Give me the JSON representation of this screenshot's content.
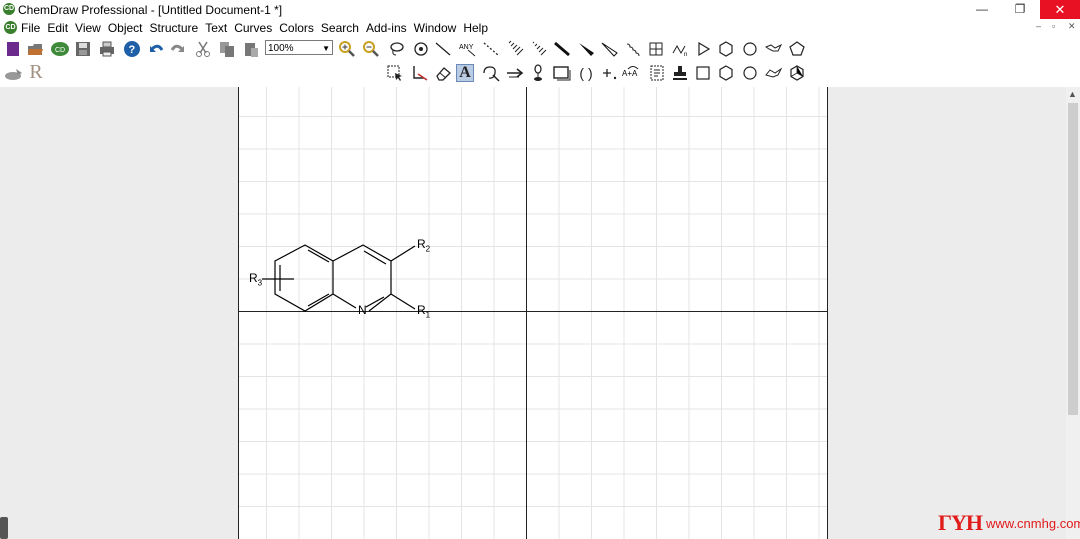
{
  "window": {
    "title": "ChemDraw Professional - [Untitled Document-1 *]",
    "app_icon": "CD",
    "controls": {
      "minimize": "—",
      "maximize": "❐",
      "close": "✕"
    }
  },
  "menubar": {
    "items": [
      "File",
      "Edit",
      "View",
      "Object",
      "Structure",
      "Text",
      "Curves",
      "Colors",
      "Search",
      "Add-ins",
      "Window",
      "Help"
    ],
    "mdi_controls": [
      "–",
      "▫",
      "✕"
    ]
  },
  "toolbar": {
    "zoom_value": "100%",
    "main_icons": [
      "new-document-icon",
      "open-icon",
      "chemdraw-online-icon",
      "save-icon",
      "print-icon",
      "help-icon",
      "undo-icon",
      "redo-icon",
      "cut-icon",
      "copy-icon",
      "paste-icon"
    ],
    "r_label": "R"
  },
  "structure": {
    "atom_n": "N",
    "r1": "R",
    "r1_sub": "1",
    "r2": "R",
    "r2_sub": "2",
    "r3": "R",
    "r3_sub": "3"
  },
  "watermark": {
    "logo": "ΓΥΗ",
    "url": "www.cnmhg.com"
  },
  "colors": {
    "close_button": "#e81123",
    "watermark": "#e11a1a",
    "grid": "#e3e3e3"
  }
}
